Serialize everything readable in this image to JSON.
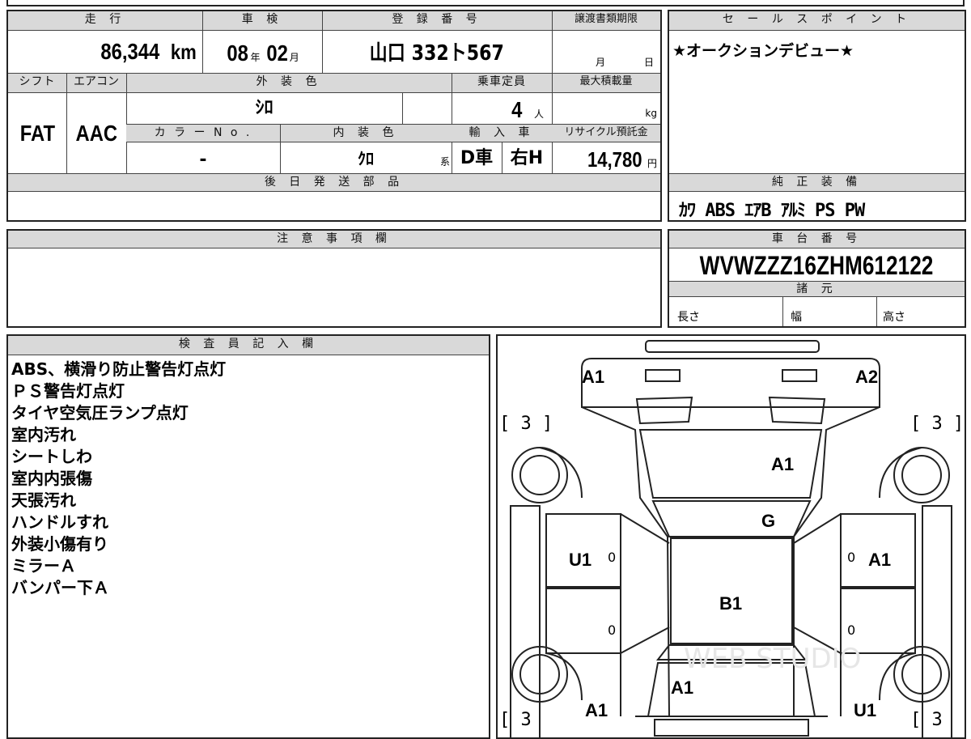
{
  "top_row": {
    "mileage_label": "走 行",
    "mileage_value": "86,344",
    "mileage_unit": "km",
    "inspection_label": "車 検",
    "inspection_year": "08",
    "inspection_year_unit": "年",
    "inspection_month": "02",
    "inspection_month_unit": "月",
    "registration_label": "登 録 番 号",
    "registration_value": "山口 332ト567",
    "transfer_deadline_label": "譲渡書類期限",
    "transfer_month_unit": "月",
    "transfer_day_unit": "日"
  },
  "mid_row": {
    "shift_label": "シフト",
    "shift_value": "FAT",
    "aircon_label": "エアコン",
    "aircon_value": "AAC",
    "exterior_color_label": "外 装 色",
    "exterior_color_value": "ｼﾛ",
    "capacity_label": "乗車定員",
    "capacity_value": "4",
    "capacity_unit": "人",
    "max_load_label": "最大積載量",
    "max_load_unit": "kg",
    "color_no_label": "カ ラ ー N o .",
    "color_no_value": "-",
    "interior_color_label": "内 装 色",
    "interior_color_value": "ｸﾛ",
    "interior_color_suffix": "系",
    "import_label": "輸 入 車",
    "import_value_1": "D車",
    "import_value_2": "右H",
    "recycle_label": "リサイクル預託金",
    "recycle_value": "14,780",
    "recycle_unit": "円"
  },
  "sales_point": {
    "label": "セ ー ル ス ポ イ ン ト",
    "text": "★オークションデビュー★"
  },
  "later_parts": {
    "label": "後 日 発 送 部 品",
    "text": ""
  },
  "genuine_equipment": {
    "label": "純 正 装 備",
    "text": "ｶﾜ ABS ｴｱB ｱﾙﾐ PS PW"
  },
  "notes": {
    "label": "注 意 事 項 欄",
    "text": ""
  },
  "chassis": {
    "label": "車 台 番 号",
    "value": "WVWZZZ16ZHM612122"
  },
  "specs": {
    "label": "諸 元",
    "length_label": "長さ",
    "width_label": "幅",
    "height_label": "高さ"
  },
  "inspector": {
    "label": "検 査 員 記 入 欄",
    "lines": [
      "ABS、横滑り防止警告灯点灯",
      "ＰＳ警告灯点灯",
      "タイヤ空気圧ランプ点灯",
      "室内汚れ",
      "シートしわ",
      "室内内張傷",
      "天張汚れ",
      "ハンドルすれ",
      "外装小傷有り",
      "ミラーＡ",
      "バンパー下Ａ"
    ]
  },
  "diagram": {
    "marks": {
      "front_left": "A1",
      "front_right": "A2",
      "hood": "A1",
      "windshield": "G",
      "left_front_door": "U1",
      "right_front_door": "A1",
      "roof": "B1",
      "rear_left": "A1",
      "trunk": "A1",
      "rear_right": "U1"
    },
    "tire_marks": {
      "front_left": "[ 3 ]",
      "front_right": "[ 3 ]",
      "rear_left": "[ 3",
      "rear_right": "[ 3"
    },
    "zero_marks": [
      "0",
      "0",
      "0",
      "0"
    ],
    "watermark": "WEB STUDIO"
  }
}
